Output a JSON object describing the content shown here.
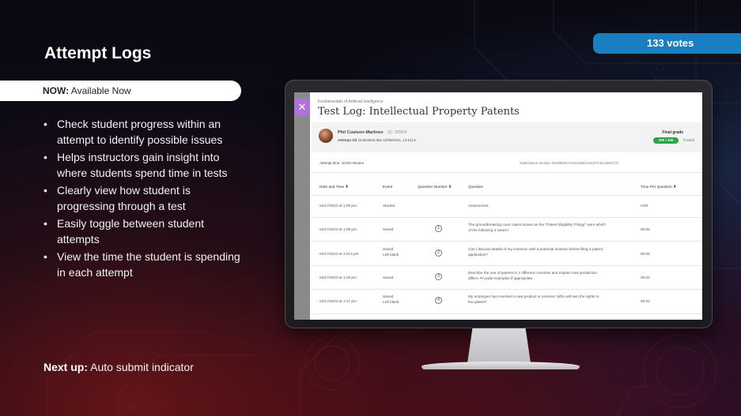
{
  "slide": {
    "title": "Attempt Logs",
    "now_label": "NOW:",
    "now_value": "Available Now",
    "votes": "133 votes",
    "bullets": [
      "Check student progress within an attempt to identify possible issues",
      "Helps instructors gain insight into where students spend time in tests",
      "Clearly view how student is progressing through a test",
      "Easily toggle between student attempts",
      "View the time the student is spending in each attempt"
    ],
    "bullet_glyph": "•",
    "next_up_label": "Next up:",
    "next_up_value": "Auto submit indicator"
  },
  "screen": {
    "close_glyph": "✕",
    "course_name": "Fundamentals of Artificial Intelligence",
    "test_title": "Test Log: Intellectual Property Patents",
    "student": {
      "name": "Phil Coulson-Martinez",
      "id": "ID: 28954",
      "attempt_label": "Attempt 2/2",
      "attempt_detail": "(Submitted late 10/08/2021, 13:21)"
    },
    "final_grade_label": "Final grade",
    "final_grade_value": "100 / 100",
    "posted_label": "Posted",
    "attempt_time": "Attempt time: 10:00 minutes",
    "receipt": "Submission receipt: 0423603CA215431BA21627C11A2647C3",
    "headers": {
      "date": "Date and Time",
      "event": "Event",
      "qnum": "Question Number",
      "question": "Question",
      "time": "Time Per Question"
    },
    "rows": [
      {
        "date": "04/17/2023 at 1:00 pm",
        "event": "Started",
        "event2": "",
        "qnum": "",
        "question": "Assessment",
        "question2": "",
        "time": "0:00"
      },
      {
        "date": "04/17/2023 at 1:08 pm",
        "event": "Saved",
        "event2": "",
        "qnum": "1",
        "question": "The groundbreaking court cases known as the \"Patent Eligibility Trilogy\" were which",
        "question2": "of the following 3 cases?",
        "time": "00:08"
      },
      {
        "date": "04/17/2023 at 1:013 pm",
        "event": "Saved",
        "event2": "Left blank",
        "qnum": "2",
        "question": "Can I discuss details of my invention with a potential investor before filing a patent",
        "question2": "application?",
        "time": "00:05"
      },
      {
        "date": "04/17/2023 at 1:16 pm",
        "event": "Saved",
        "event2": "",
        "qnum": "3",
        "question": "Describe the use of patents in 2 different countries and explain how jurisdiction",
        "question2": "differs. Provide examples if appropriate.",
        "time": "00:03"
      },
      {
        "date": "04/17/2023 at 1:17 pm",
        "event": "Saved",
        "event2": "Left blank",
        "qnum": "4",
        "question": "My employee has invented a new product or process: Who will own the rights to",
        "question2": "the patent?",
        "time": "00:01"
      }
    ]
  }
}
